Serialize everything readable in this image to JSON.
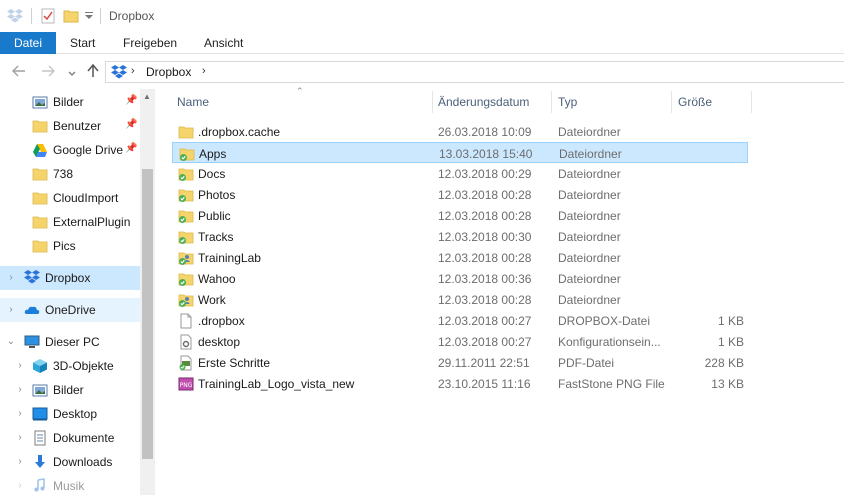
{
  "window": {
    "title": "Dropbox"
  },
  "ribbon": {
    "tabs": [
      "Datei",
      "Start",
      "Freigeben",
      "Ansicht"
    ]
  },
  "address": {
    "path": [
      "Dropbox"
    ]
  },
  "sidebar": {
    "items": [
      {
        "label": "Bilder",
        "icon": "pictures-icon",
        "pinned": true
      },
      {
        "label": "Benutzer",
        "icon": "folder-icon",
        "pinned": true
      },
      {
        "label": "Google Drive",
        "icon": "google-drive-icon",
        "pinned": true
      },
      {
        "label": "738",
        "icon": "folder-icon"
      },
      {
        "label": "CloudImport",
        "icon": "folder-icon"
      },
      {
        "label": "ExternalPlugin",
        "icon": "folder-icon"
      },
      {
        "label": "Pics",
        "icon": "folder-icon"
      },
      {
        "label": "Dropbox",
        "icon": "dropbox-icon"
      },
      {
        "label": "OneDrive",
        "icon": "onedrive-icon"
      },
      {
        "label": "Dieser PC",
        "icon": "computer-icon"
      },
      {
        "label": "3D-Objekte",
        "icon": "3d-objects-icon"
      },
      {
        "label": "Bilder",
        "icon": "pictures-icon"
      },
      {
        "label": "Desktop",
        "icon": "desktop-icon"
      },
      {
        "label": "Dokumente",
        "icon": "documents-icon"
      },
      {
        "label": "Downloads",
        "icon": "downloads-icon"
      },
      {
        "label": "Musik",
        "icon": "music-icon"
      }
    ]
  },
  "columns": {
    "name": "Name",
    "date": "Änderungsdatum",
    "type": "Typ",
    "size": "Größe"
  },
  "files": [
    {
      "name": ".dropbox.cache",
      "date": "26.03.2018 10:09",
      "type": "Dateiordner",
      "size": "",
      "icon": "folder-icon"
    },
    {
      "name": "Apps",
      "date": "13.03.2018 15:40",
      "type": "Dateiordner",
      "size": "",
      "icon": "synced-folder-icon"
    },
    {
      "name": "Docs",
      "date": "12.03.2018 00:29",
      "type": "Dateiordner",
      "size": "",
      "icon": "synced-folder-icon"
    },
    {
      "name": "Photos",
      "date": "12.03.2018 00:28",
      "type": "Dateiordner",
      "size": "",
      "icon": "synced-folder-icon"
    },
    {
      "name": "Public",
      "date": "12.03.2018 00:28",
      "type": "Dateiordner",
      "size": "",
      "icon": "synced-folder-icon"
    },
    {
      "name": "Tracks",
      "date": "12.03.2018 00:30",
      "type": "Dateiordner",
      "size": "",
      "icon": "synced-folder-icon"
    },
    {
      "name": "TrainingLab",
      "date": "12.03.2018 00:28",
      "type": "Dateiordner",
      "size": "",
      "icon": "shared-folder-icon"
    },
    {
      "name": "Wahoo",
      "date": "12.03.2018 00:36",
      "type": "Dateiordner",
      "size": "",
      "icon": "synced-folder-icon"
    },
    {
      "name": "Work",
      "date": "12.03.2018 00:28",
      "type": "Dateiordner",
      "size": "",
      "icon": "shared-folder-icon"
    },
    {
      "name": ".dropbox",
      "date": "12.03.2018 00:27",
      "type": "DROPBOX-Datei",
      "size": "1 KB",
      "icon": "file-icon"
    },
    {
      "name": "desktop",
      "date": "12.03.2018 00:27",
      "type": "Konfigurationsein...",
      "size": "1 KB",
      "icon": "settings-file-icon"
    },
    {
      "name": "Erste Schritte",
      "date": "29.11.2011 22:51",
      "type": "PDF-Datei",
      "size": "228 KB",
      "icon": "pdf-file-icon"
    },
    {
      "name": "TrainingLab_Logo_vista_new",
      "date": "23.10.2015 11:16",
      "type": "FastStone PNG File",
      "size": "13 KB",
      "icon": "png-file-icon"
    }
  ],
  "colors": {
    "accent": "#1979ca",
    "selection": "#cce8ff",
    "folder": "#f5d56b",
    "sync_check": "#4caf50"
  }
}
